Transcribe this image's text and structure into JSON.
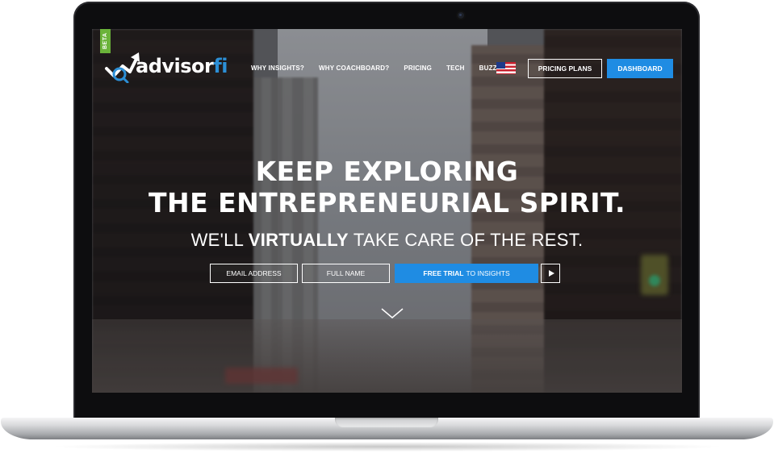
{
  "brand": {
    "beta": "BETA",
    "name_main": "advisor",
    "name_accent": "fi"
  },
  "nav": {
    "items": [
      "WHY INSIGHTS?",
      "WHY COACHBOARD?",
      "PRICING",
      "TECH",
      "BUZZ"
    ],
    "flag_icon": "us-flag-icon",
    "pricing_plans": "PRICING PLANS",
    "dashboard": "DASHBOARD"
  },
  "hero": {
    "line1": "KEEP EXPLORING",
    "line2": "THE ENTREPRENEURIAL SPIRIT.",
    "sub_pre": "WE'LL",
    "sub_bold": "VIRTUALLY",
    "sub_post": "TAKE CARE OF THE REST."
  },
  "form": {
    "email_placeholder": "EMAIL ADDRESS",
    "name_placeholder": "FULL NAME",
    "trial_bold": "FREE TRIAL",
    "trial_rest": "TO INSIGHTS",
    "play_icon": "play-icon"
  },
  "scroll_icon": "chevron-down-icon",
  "colors": {
    "accent": "#1f8ce3",
    "beta": "#6bb33a",
    "text": "#ffffff"
  }
}
